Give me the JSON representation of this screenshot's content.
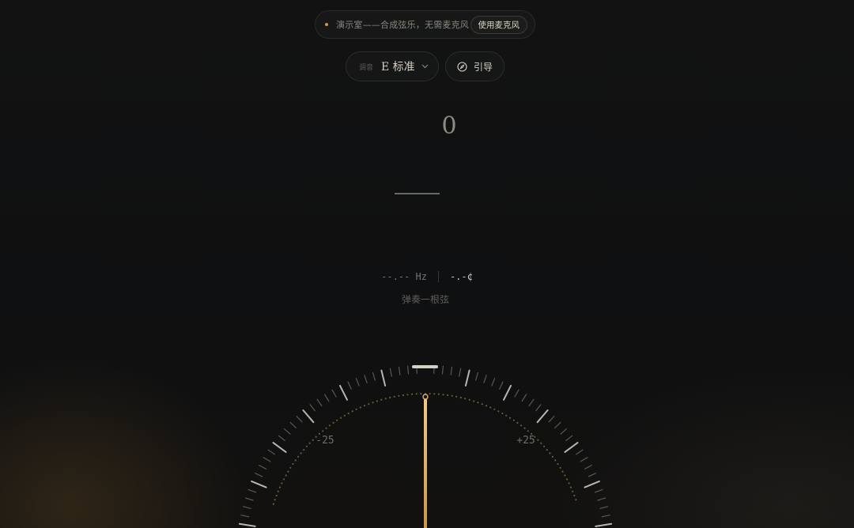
{
  "banner": {
    "message": "演示室——合成弦乐，无需麦克风",
    "mic_button": "使用麦克风"
  },
  "tuning": {
    "label": "调音",
    "value": "E 标准",
    "chevron_icon": "chevron-down-icon"
  },
  "guide": {
    "label": "引导",
    "icon": "compass-icon"
  },
  "note": {
    "name": "0"
  },
  "readout": {
    "hz": "--.-- Hz",
    "cents": "-.-¢",
    "hint": "弹奏一根弦"
  },
  "gauge": {
    "center_label": "0",
    "left_label": "-25",
    "right_label": "+25",
    "needle_cents": 0,
    "accent_color": "#e0b260"
  }
}
